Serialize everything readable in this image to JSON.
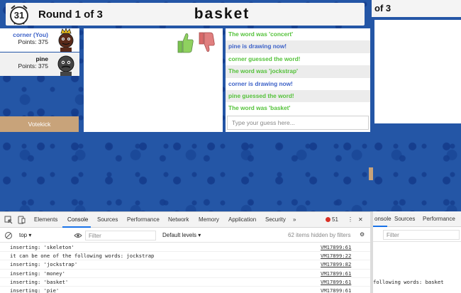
{
  "game": {
    "timer": "31",
    "round": "Round 1 of 3",
    "word": "basket",
    "players": [
      {
        "name": "corner (You)",
        "points": "Points: 375",
        "name_color": "#3d62c8"
      },
      {
        "name": "pine",
        "points": "Points: 375",
        "name_color": "#111111"
      }
    ],
    "votekick": "Votekick",
    "chat": [
      {
        "text": "The word was 'concert'",
        "color": "green"
      },
      {
        "text": "pine is drawing now!",
        "color": "blue"
      },
      {
        "text": "corner guessed the word!",
        "color": "green"
      },
      {
        "text": "The word was 'jockstrap'",
        "color": "green"
      },
      {
        "text": "corner is drawing now!",
        "color": "blue"
      },
      {
        "text": "pine guessed the word!",
        "color": "green"
      },
      {
        "text": "The word was 'basket'",
        "color": "green"
      }
    ],
    "guess_placeholder": "Type your guess here..."
  },
  "right_window": {
    "round_partial": "of 3"
  },
  "devtools": {
    "tabs": [
      "Elements",
      "Console",
      "Sources",
      "Performance",
      "Network",
      "Memory",
      "Application",
      "Security",
      "»"
    ],
    "active_tab": "Console",
    "error_count": "51",
    "context": "top",
    "filter_placeholder": "Filter",
    "levels": "Default levels",
    "hidden": "62 items hidden by filters",
    "log": [
      {
        "text": "inserting: 'skeleton'",
        "source": "VM17899:61"
      },
      {
        "text": "it can be one of the following words: jockstrap",
        "source": "VM17899:22"
      },
      {
        "text": "inserting: 'jockstrap'",
        "source": "VM17899:82"
      },
      {
        "text": "inserting: 'money'",
        "source": "VM17899:61"
      },
      {
        "text": "inserting: 'basket'",
        "source": "VM17899:61"
      },
      {
        "text": "inserting: 'pie'",
        "source": "VM17899:61"
      }
    ],
    "right_tabs": [
      "onsole",
      "Sources",
      "Performance"
    ],
    "right_filter_placeholder": "Filter",
    "right_log_line": "following words: basket"
  },
  "colors": {
    "background": "#2456a6",
    "chat_green": "#55c23b",
    "chat_blue": "#3d62c8",
    "votekick": "#c8a37a",
    "devtools_accent": "#1a73e8"
  }
}
